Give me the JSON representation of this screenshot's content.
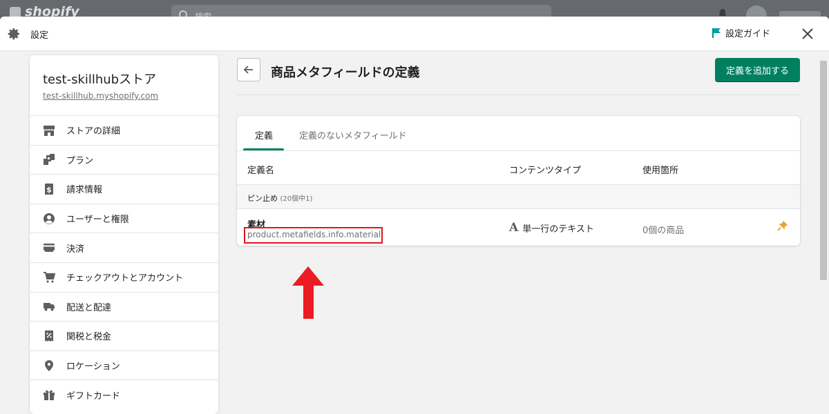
{
  "admin": {
    "logo_text": "shopify",
    "search_placeholder": "検索"
  },
  "modal": {
    "title": "設定",
    "guide_label": "設定ガイド"
  },
  "sidebar": {
    "store_name": "test-skillhubストア",
    "store_url": "test-skillhub.myshopify.com",
    "items": [
      {
        "label": "ストアの詳細",
        "icon": "store-icon"
      },
      {
        "label": "プラン",
        "icon": "plan-icon"
      },
      {
        "label": "請求情報",
        "icon": "billing-icon"
      },
      {
        "label": "ユーザーと権限",
        "icon": "user-icon"
      },
      {
        "label": "決済",
        "icon": "payment-icon"
      },
      {
        "label": "チェックアウトとアカウント",
        "icon": "cart-icon"
      },
      {
        "label": "配送と配達",
        "icon": "truck-icon"
      },
      {
        "label": "関税と税金",
        "icon": "tax-icon"
      },
      {
        "label": "ロケーション",
        "icon": "location-icon"
      },
      {
        "label": "ギフトカード",
        "icon": "gift-icon"
      }
    ]
  },
  "page": {
    "title": "商品メタフィールドの定義",
    "add_button": "定義を追加する"
  },
  "tabs": [
    {
      "label": "定義",
      "active": true
    },
    {
      "label": "定義のないメタフィールド",
      "active": false
    }
  ],
  "table": {
    "headers": {
      "name": "定義名",
      "content_type": "コンテンツタイプ",
      "usage": "使用箇所"
    },
    "pinned_label": "ピン止め",
    "pinned_count": "(20個中1)",
    "rows": [
      {
        "name": "素材",
        "key": "product.metafields.info.material",
        "content_type": "単一行のテキスト",
        "type_icon": "A",
        "usage": "0個の商品"
      }
    ]
  },
  "colors": {
    "primary_green": "#008060",
    "highlight_red": "#e1141c",
    "pin_orange": "#e8a33b"
  }
}
